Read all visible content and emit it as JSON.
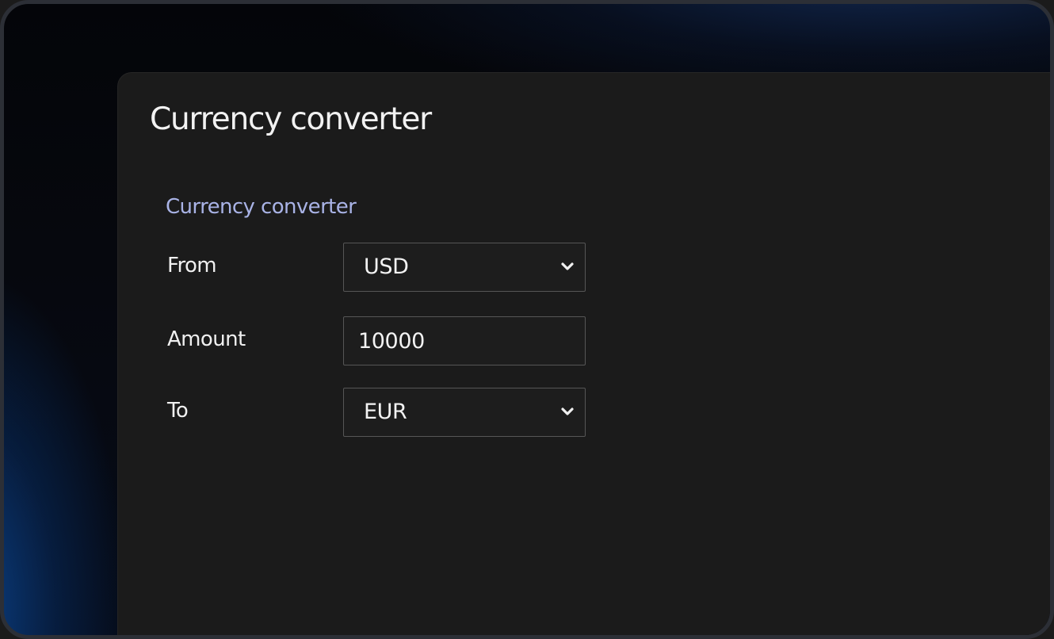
{
  "window": {
    "title": "Currency converter"
  },
  "converter": {
    "section_title": "Currency converter",
    "from": {
      "label": "From",
      "selected": "USD",
      "icon": "chevron-down-icon"
    },
    "amount": {
      "label": "Amount",
      "value": "10000"
    },
    "to": {
      "label": "To",
      "selected": "EUR",
      "icon": "chevron-down-icon"
    }
  },
  "colors": {
    "window_background": "#1b1b1b",
    "section_title": "#a9b3e6",
    "text": "#f2f2f2",
    "field_border": "#565656",
    "backdrop_accent": "#0c4896"
  }
}
